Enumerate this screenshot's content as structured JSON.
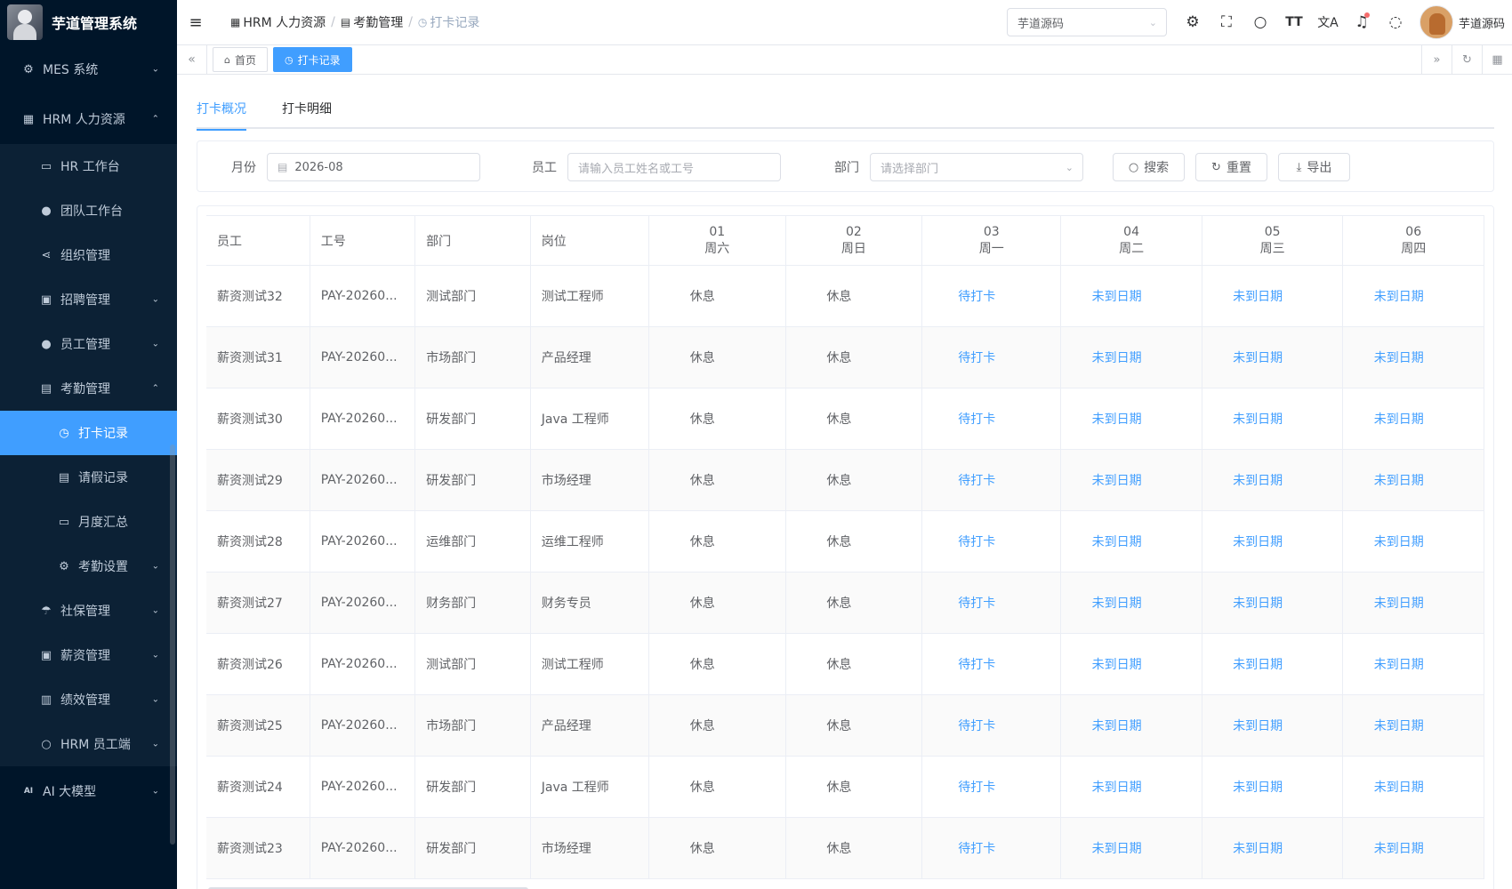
{
  "app": {
    "title": "芋道管理系统"
  },
  "sidebar": {
    "items": [
      {
        "label": "MES 系统"
      },
      {
        "label": "HRM 人力资源"
      },
      {
        "label": "HR 工作台"
      },
      {
        "label": "团队工作台"
      },
      {
        "label": "组织管理"
      },
      {
        "label": "招聘管理"
      },
      {
        "label": "员工管理"
      },
      {
        "label": "考勤管理"
      },
      {
        "label": "打卡记录"
      },
      {
        "label": "请假记录"
      },
      {
        "label": "月度汇总"
      },
      {
        "label": "考勤设置"
      },
      {
        "label": "社保管理"
      },
      {
        "label": "薪资管理"
      },
      {
        "label": "绩效管理"
      },
      {
        "label": "HRM 员工端"
      },
      {
        "label": "AI 大模型"
      }
    ]
  },
  "header": {
    "breadcrumb": [
      "HRM 人力资源",
      "考勤管理",
      "打卡记录"
    ],
    "tenant": "芋道源码",
    "username": "芋道源码"
  },
  "tagsbar": {
    "tags": [
      "首页",
      "打卡记录"
    ]
  },
  "tabs": [
    "打卡概况",
    "打卡明细"
  ],
  "search": {
    "month_label": "月份",
    "month_value": "2026-08",
    "employee_label": "员工",
    "employee_placeholder": "请输入员工姓名或工号",
    "dept_label": "部门",
    "dept_placeholder": "请选择部门",
    "search_btn": "搜索",
    "reset_btn": "重置",
    "export_btn": "导出"
  },
  "table": {
    "columns": [
      "员工",
      "工号",
      "部门",
      "岗位"
    ],
    "days": [
      {
        "date": "01",
        "weekday": "周六"
      },
      {
        "date": "02",
        "weekday": "周日"
      },
      {
        "date": "03",
        "weekday": "周一"
      },
      {
        "date": "04",
        "weekday": "周二"
      },
      {
        "date": "05",
        "weekday": "周三"
      },
      {
        "date": "06",
        "weekday": "周四"
      }
    ],
    "rows": [
      {
        "name": "薪资测试32",
        "no": "PAY-20260...",
        "dept": "测试部门",
        "post": "测试工程师",
        "d": [
          "休息",
          "休息",
          "待打卡",
          "未到日期",
          "未到日期",
          "未到日期"
        ]
      },
      {
        "name": "薪资测试31",
        "no": "PAY-20260...",
        "dept": "市场部门",
        "post": "产品经理",
        "d": [
          "休息",
          "休息",
          "待打卡",
          "未到日期",
          "未到日期",
          "未到日期"
        ]
      },
      {
        "name": "薪资测试30",
        "no": "PAY-20260...",
        "dept": "研发部门",
        "post": "Java 工程师",
        "d": [
          "休息",
          "休息",
          "待打卡",
          "未到日期",
          "未到日期",
          "未到日期"
        ]
      },
      {
        "name": "薪资测试29",
        "no": "PAY-20260...",
        "dept": "研发部门",
        "post": "市场经理",
        "d": [
          "休息",
          "休息",
          "待打卡",
          "未到日期",
          "未到日期",
          "未到日期"
        ]
      },
      {
        "name": "薪资测试28",
        "no": "PAY-20260...",
        "dept": "运维部门",
        "post": "运维工程师",
        "d": [
          "休息",
          "休息",
          "待打卡",
          "未到日期",
          "未到日期",
          "未到日期"
        ]
      },
      {
        "name": "薪资测试27",
        "no": "PAY-20260...",
        "dept": "财务部门",
        "post": "财务专员",
        "d": [
          "休息",
          "休息",
          "待打卡",
          "未到日期",
          "未到日期",
          "未到日期"
        ]
      },
      {
        "name": "薪资测试26",
        "no": "PAY-20260...",
        "dept": "测试部门",
        "post": "测试工程师",
        "d": [
          "休息",
          "休息",
          "待打卡",
          "未到日期",
          "未到日期",
          "未到日期"
        ]
      },
      {
        "name": "薪资测试25",
        "no": "PAY-20260...",
        "dept": "市场部门",
        "post": "产品经理",
        "d": [
          "休息",
          "休息",
          "待打卡",
          "未到日期",
          "未到日期",
          "未到日期"
        ]
      },
      {
        "name": "薪资测试24",
        "no": "PAY-20260...",
        "dept": "研发部门",
        "post": "Java 工程师",
        "d": [
          "休息",
          "休息",
          "待打卡",
          "未到日期",
          "未到日期",
          "未到日期"
        ]
      },
      {
        "name": "薪资测试23",
        "no": "PAY-20260...",
        "dept": "研发部门",
        "post": "市场经理",
        "d": [
          "休息",
          "休息",
          "待打卡",
          "未到日期",
          "未到日期",
          "未到日期"
        ]
      }
    ]
  },
  "colors": {
    "primary": "#409eff",
    "sidebar_bg": "#001529",
    "sidebar_sub_bg": "#0c2135"
  }
}
